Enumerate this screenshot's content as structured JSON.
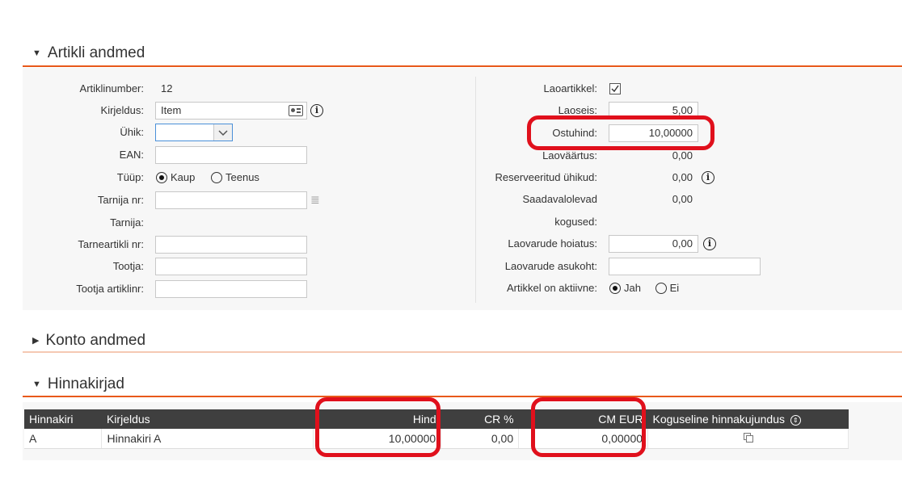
{
  "sections": {
    "artikli": {
      "title": "Artikli andmed"
    },
    "konto": {
      "title": "Konto andmed"
    },
    "hinnakirjad": {
      "title": "Hinnakirjad"
    }
  },
  "left": {
    "artiklinumber": {
      "label": "Artiklinumber:",
      "value": "12"
    },
    "kirjeldus": {
      "label": "Kirjeldus:",
      "value": "Item"
    },
    "uhik": {
      "label": "Ühik:",
      "value": ""
    },
    "ean": {
      "label": "EAN:",
      "value": ""
    },
    "tuup": {
      "label": "Tüüp:",
      "options": [
        "Kaup",
        "Teenus"
      ],
      "selected": "Kaup"
    },
    "tarnija_nr": {
      "label": "Tarnija nr:",
      "value": ""
    },
    "tarnija": {
      "label": "Tarnija:",
      "value": ""
    },
    "tarneartikli_nr": {
      "label": "Tarneartikli nr:",
      "value": ""
    },
    "tootja": {
      "label": "Tootja:",
      "value": ""
    },
    "tootja_artiklinr": {
      "label": "Tootja artiklinr:",
      "value": ""
    }
  },
  "right": {
    "laoartikkel": {
      "label": "Laoartikkel:",
      "checked": true
    },
    "laoseis": {
      "label": "Laoseis:",
      "value": "5,00"
    },
    "ostuhind": {
      "label": "Ostuhind:",
      "value": "10,00000"
    },
    "laovaartus": {
      "label": "Laoväärtus:",
      "value": "0,00"
    },
    "reserveeritud": {
      "label": "Reserveeritud ühikud:",
      "value": "0,00"
    },
    "saadaval": {
      "label1": "Saadavalolevad",
      "label2": "kogused:",
      "value": "0,00"
    },
    "hoiatus": {
      "label": "Laovarude hoiatus:",
      "value": "0,00"
    },
    "asukoht": {
      "label": "Laovarude asukoht:",
      "value": ""
    },
    "aktiivne": {
      "label": "Artikkel on aktiivne:",
      "options": [
        "Jah",
        "Ei"
      ],
      "selected": "Jah"
    }
  },
  "price_table": {
    "headers": [
      "Hinnakiri",
      "Kirjeldus",
      "Hind",
      "CR %",
      "CM EUR",
      "Koguseline hinnakujundus"
    ],
    "rows": [
      {
        "hinnakiri": "A",
        "kirjeldus": "Hinnakiri A",
        "hind": "10,00000",
        "cr": "0,00",
        "cm": "0,00000"
      }
    ]
  },
  "icons": {
    "info": "i",
    "list": "≣"
  },
  "colors": {
    "accent": "#e8591a",
    "highlight": "#e0101c",
    "header_bg": "#3f3f3f"
  }
}
